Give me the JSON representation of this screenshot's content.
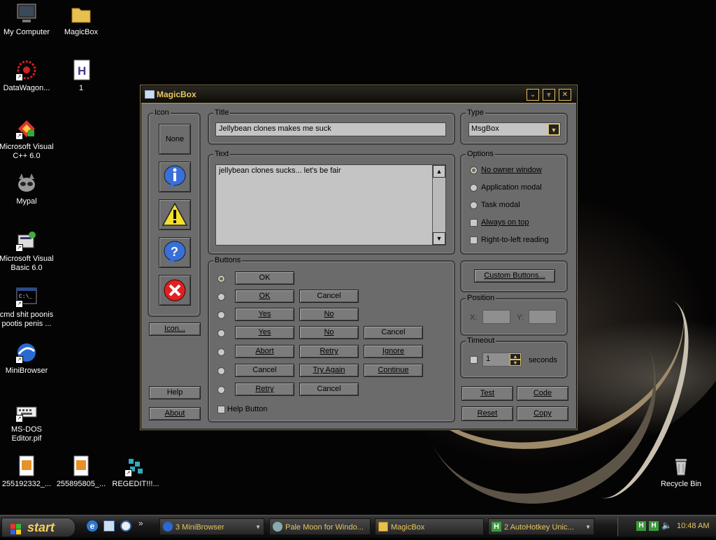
{
  "desktop_icons": [
    {
      "label": "My Computer"
    },
    {
      "label": "MagicBox"
    },
    {
      "label": "DataWagon..."
    },
    {
      "label": "1"
    },
    {
      "label": "Microsoft Visual\nC++ 6.0"
    },
    {
      "label": "Mypal"
    },
    {
      "label": "Microsoft Visual\nBasic 6.0"
    },
    {
      "label": "cmd shit poonis\npootis penis ..."
    },
    {
      "label": "MiniBrowser"
    },
    {
      "label": "MS-DOS\nEditor.pif"
    },
    {
      "label": "255192332_..."
    },
    {
      "label": "255895805_..."
    },
    {
      "label": "REGEDIT!!!..."
    },
    {
      "label": "Recycle Bin"
    }
  ],
  "window": {
    "title": "MagicBox",
    "icon_group": {
      "title": "Icon",
      "none_label": "None",
      "icon_button": "Icon...",
      "help_button": "Help",
      "about_button": "About"
    },
    "title_group": {
      "title": "Title",
      "value": "Jellybean clones makes me suck"
    },
    "text_group": {
      "title": "Text",
      "value": "jellybean clones sucks... let's be fair"
    },
    "buttons_group": {
      "title": "Buttons",
      "rows": [
        [
          "OK"
        ],
        [
          "OK",
          "Cancel"
        ],
        [
          "Yes",
          "No"
        ],
        [
          "Yes",
          "No",
          "Cancel"
        ],
        [
          "Abort",
          "Retry",
          "Ignore"
        ],
        [
          "Cancel",
          "Try Again",
          "Continue"
        ],
        [
          "Retry",
          "Cancel"
        ]
      ],
      "selected_row": 0,
      "help_button_label": "Help Button"
    },
    "type_group": {
      "title": "Type",
      "selected": "MsgBox"
    },
    "options_group": {
      "title": "Options",
      "radios": [
        "No owner window",
        "Application modal",
        "Task modal"
      ],
      "selected_radio": 0,
      "checkboxes": [
        "Always on top",
        "Right-to-left reading"
      ]
    },
    "custom_buttons": "Custom Buttons...",
    "position_group": {
      "title": "Position",
      "x_label": "X:",
      "y_label": "Y:"
    },
    "timeout_group": {
      "title": "Timeout",
      "value": "1",
      "unit": "seconds"
    },
    "actions": {
      "test": "Test",
      "code": "Code",
      "reset": "Reset",
      "copy": "Copy"
    }
  },
  "taskbar": {
    "start": "start",
    "tasks": [
      {
        "label": "3 MiniBrowser"
      },
      {
        "label": "Pale Moon for Windo..."
      },
      {
        "label": "MagicBox"
      },
      {
        "label": "2 AutoHotkey Unic..."
      }
    ],
    "clock": "10:48 AM"
  }
}
